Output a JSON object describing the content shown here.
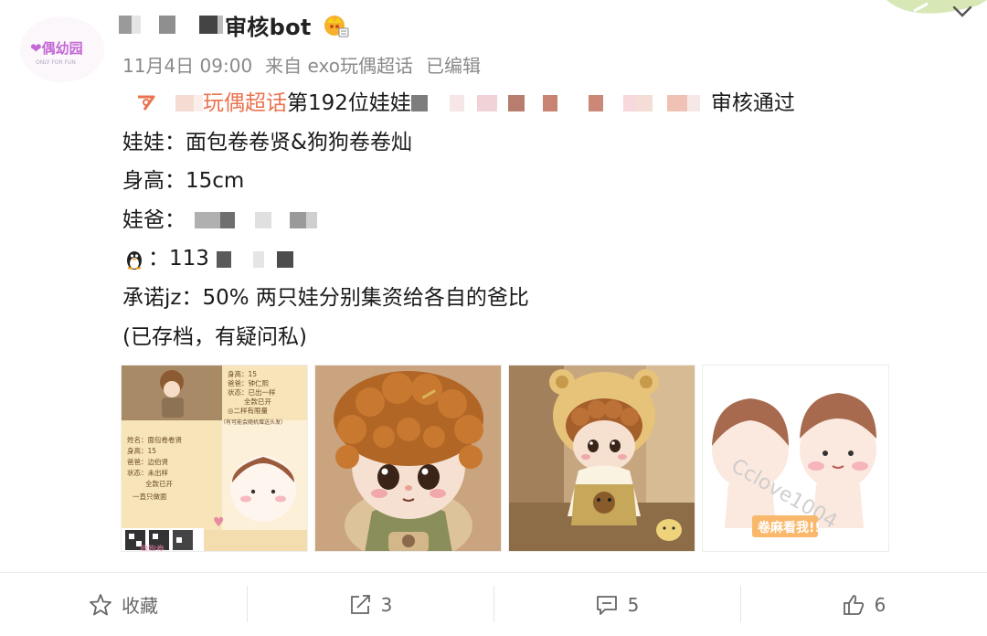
{
  "post": {
    "username": "审核bot",
    "timestamp": "11月4日 09:00",
    "source": "来自 exo玩偶超话",
    "edited": "已编辑",
    "lines": {
      "supertopic_link": "玩偶超话",
      "approval_prefix": "第192位娃娃",
      "approval_suffix": "审核通过",
      "doll_label": "娃娃：",
      "doll_value": "面包卷卷贤&狗狗卷卷灿",
      "height_label": "身高：",
      "height_value": "15cm",
      "owner_label": "娃爸：",
      "qq_label": "：",
      "qq_value": "113",
      "promise_label": "承诺jz：",
      "promise_value": "50% 两只娃分别集资给各自的爸比",
      "archived": "(已存档，有疑问私)"
    }
  },
  "gallery": {
    "card1": {
      "title_lines": [
        "身高：15",
        "爸爸：钟仁熙",
        "状态：已出一样",
        "全款已开",
        "◎二样有限量",
        "（有可能会随机赠送头发）"
      ],
      "list_lines": [
        "姓名：面包卷卷贤",
        "身高：15",
        "爸爸：边伯贤",
        "状态：未出样",
        "全款已开",
        "一直只做面"
      ],
      "footer": "狗狗卷"
    },
    "card4": {
      "watermark": "Cclove1004",
      "badge": "卷麻看我!!"
    }
  },
  "actions": {
    "favorite": "收藏",
    "repost_count": "3",
    "comment_count": "5",
    "like_count": "6"
  },
  "colors": {
    "link": "#eb7350",
    "meta": "#8a8a8a",
    "badge_bg": "#f9b86b"
  }
}
